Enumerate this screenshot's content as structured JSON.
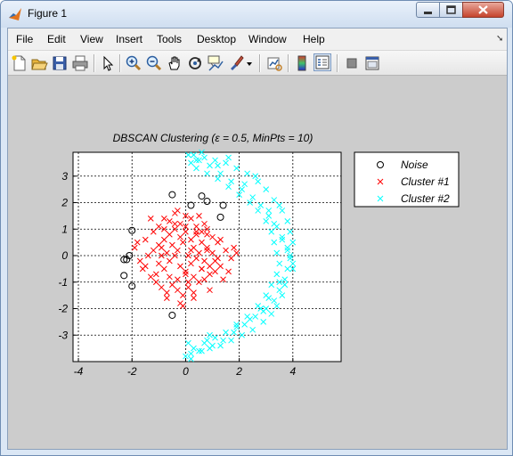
{
  "window": {
    "title": "Figure 1"
  },
  "menu": {
    "items": [
      "File",
      "Edit",
      "View",
      "Insert",
      "Tools",
      "Desktop",
      "Window",
      "Help"
    ]
  },
  "toolbar": {
    "icons": [
      "new-figure-icon",
      "open-file-icon",
      "save-icon",
      "print-icon",
      "edit-plot-arrow-icon",
      "zoom-in-icon",
      "zoom-out-icon",
      "pan-hand-icon",
      "rotate-3d-icon",
      "data-cursor-icon",
      "brush-icon",
      "brush-dropdown-icon",
      "link-plot-icon",
      "insert-colorbar-icon",
      "insert-legend-icon",
      "hide-plot-tools-icon",
      "show-plot-tools-icon"
    ]
  },
  "chart_data": {
    "type": "scatter",
    "title": "DBSCAN Clustering (ε = 0.5, MinPts = 10)",
    "xlim": [
      -4.2,
      5.8
    ],
    "ylim": [
      -4,
      3.9
    ],
    "xticks": [
      "-4",
      "-2",
      "0",
      "2",
      "4"
    ],
    "yticks": [
      "3",
      "2",
      "1",
      "0",
      "-1",
      "-2",
      "-3"
    ],
    "grid": true,
    "legend_position": "right-outside-top",
    "series": [
      {
        "name": "Noise",
        "marker": "o",
        "color": "#000000",
        "x": [
          -0.5,
          0.2,
          0.6,
          0.8,
          1.4,
          1.3,
          -2.0,
          -2.1,
          -2.2,
          -2.3,
          -2.3,
          -2.0,
          -0.5
        ],
        "y": [
          2.3,
          1.9,
          2.25,
          2.05,
          1.9,
          1.45,
          0.95,
          0.0,
          -0.15,
          -0.15,
          -0.75,
          -1.15,
          -2.25
        ]
      },
      {
        "name": "Cluster #1",
        "marker": "x",
        "color": "#ff0000",
        "x": [
          -1.9,
          -1.7,
          -1.5,
          -1.2,
          -1.0,
          -0.8,
          -0.6,
          -0.4,
          -0.2,
          0.0,
          0.2,
          0.4,
          0.6,
          0.8,
          1.0,
          1.2,
          1.5,
          1.7,
          1.9,
          -1.6,
          -1.3,
          -1.1,
          -0.9,
          -0.7,
          -0.5,
          -0.3,
          -0.1,
          0.1,
          0.3,
          0.5,
          0.7,
          0.9,
          1.1,
          1.3,
          1.6,
          -1.4,
          -1.2,
          -1.0,
          -0.8,
          -0.6,
          -0.4,
          -0.2,
          0.0,
          0.2,
          0.4,
          0.6,
          0.8,
          1.0,
          1.2,
          -1.0,
          -0.8,
          -0.6,
          -0.4,
          -0.2,
          0.0,
          0.2,
          0.4,
          0.6,
          0.8,
          -0.9,
          -0.7,
          -0.5,
          -0.3,
          -0.1,
          0.1,
          0.3,
          0.5,
          0.7,
          0.9,
          -1.1,
          -0.6,
          -0.3,
          0.0,
          0.3,
          0.6,
          1.1,
          -0.8,
          -0.4,
          0.0,
          0.4,
          0.8,
          1.3,
          -0.7,
          -0.2,
          0.3,
          0.9,
          -1.5,
          -1.8,
          1.8,
          -0.1,
          0.5,
          -1.3,
          1.4,
          -0.3,
          0.1,
          0.7,
          -0.9,
          0.2
        ],
        "y": [
          0.3,
          -0.2,
          0.6,
          0.9,
          1.1,
          1.4,
          1.3,
          1.6,
          1.2,
          1.5,
          1.4,
          1.1,
          0.9,
          0.8,
          0.7,
          0.5,
          0.2,
          -0.1,
          0.1,
          -0.5,
          -0.8,
          -1.0,
          -1.2,
          -1.4,
          -1.1,
          -1.3,
          -1.5,
          -1.2,
          -1.4,
          -1.0,
          -0.9,
          -0.7,
          -0.6,
          -0.4,
          -0.6,
          0.0,
          0.2,
          0.4,
          0.6,
          0.8,
          1.0,
          0.7,
          0.9,
          0.6,
          0.8,
          0.5,
          0.3,
          0.1,
          -0.1,
          -0.3,
          -0.5,
          -0.2,
          0.0,
          -0.4,
          -0.6,
          -0.3,
          -0.1,
          -0.5,
          0.2,
          0.3,
          0.1,
          0.4,
          0.2,
          0.5,
          0.0,
          0.3,
          0.1,
          -0.2,
          -0.4,
          -0.7,
          -0.8,
          -0.9,
          -0.7,
          -0.8,
          -0.5,
          -0.2,
          1.0,
          1.2,
          1.1,
          0.9,
          1.0,
          0.6,
          -1.6,
          -1.8,
          -1.6,
          -1.3,
          -0.4,
          0.5,
          0.3,
          -1.9,
          1.5,
          1.4,
          -0.9,
          1.7,
          -1.0,
          1.2,
          0.0,
          0.2
        ]
      },
      {
        "name": "Cluster #2",
        "marker": "x",
        "color": "#00ffff",
        "x": [
          0.1,
          0.5,
          0.9,
          1.3,
          1.7,
          2.1,
          2.5,
          2.8,
          3.1,
          3.4,
          3.6,
          3.8,
          3.9,
          4.0,
          4.0,
          3.9,
          3.8,
          3.6,
          3.3,
          3.0,
          2.7,
          2.3,
          1.9,
          1.5,
          1.1,
          0.7,
          0.3,
          0.0,
          0.2,
          0.6,
          1.0,
          1.4,
          1.8,
          2.2,
          2.6,
          3.0,
          3.3,
          3.5,
          3.7,
          3.8,
          3.6,
          3.4,
          3.2,
          2.9,
          2.5,
          2.1,
          1.7,
          1.3,
          0.9,
          0.5,
          0.2,
          0.4,
          0.8,
          1.2,
          1.6,
          2.0,
          2.4,
          2.7,
          3.0,
          3.2,
          3.3,
          3.4,
          3.5,
          3.4,
          3.2,
          3.0,
          2.7,
          2.3,
          1.9,
          1.5,
          1.1,
          0.7,
          0.3,
          0.1,
          0.6,
          1.6,
          2.6,
          3.5,
          3.9,
          3.7,
          2.9,
          1.9,
          0.9,
          0.2,
          2.4,
          3.1,
          3.6,
          4.0,
          3.1,
          2.2,
          1.2,
          0.4,
          2.8,
          3.5,
          3.8,
          3.3,
          0.8
        ],
        "y": [
          3.8,
          3.6,
          3.4,
          3.1,
          2.8,
          2.5,
          2.2,
          1.9,
          1.5,
          1.1,
          0.7,
          0.3,
          -0.1,
          -0.5,
          0.5,
          0.9,
          1.3,
          1.7,
          2.1,
          2.5,
          2.8,
          3.1,
          3.3,
          3.5,
          3.6,
          3.7,
          3.8,
          -3.8,
          -3.7,
          -3.6,
          -3.4,
          -3.2,
          -2.9,
          -2.6,
          -2.3,
          -2.0,
          -1.7,
          -1.3,
          -0.9,
          -0.5,
          -1.5,
          -1.9,
          -2.2,
          -2.5,
          -2.8,
          -3.0,
          -3.2,
          -3.4,
          -3.5,
          -3.6,
          3.5,
          3.3,
          3.1,
          2.9,
          2.6,
          2.3,
          2.0,
          1.7,
          1.3,
          0.9,
          0.5,
          0.1,
          -0.3,
          -0.7,
          -1.1,
          -1.5,
          -1.9,
          -2.3,
          -2.6,
          -2.9,
          -3.1,
          -3.3,
          -3.5,
          -3.3,
          3.9,
          3.7,
          3.0,
          1.9,
          0.0,
          -1.1,
          -2.1,
          -2.7,
          -3.0,
          -3.9,
          -2.4,
          -1.6,
          0.6,
          -0.3,
          1.7,
          2.7,
          3.4,
          3.6,
          -2.0,
          -1.0,
          0.2,
          1.2,
          -3.2
        ]
      }
    ]
  }
}
